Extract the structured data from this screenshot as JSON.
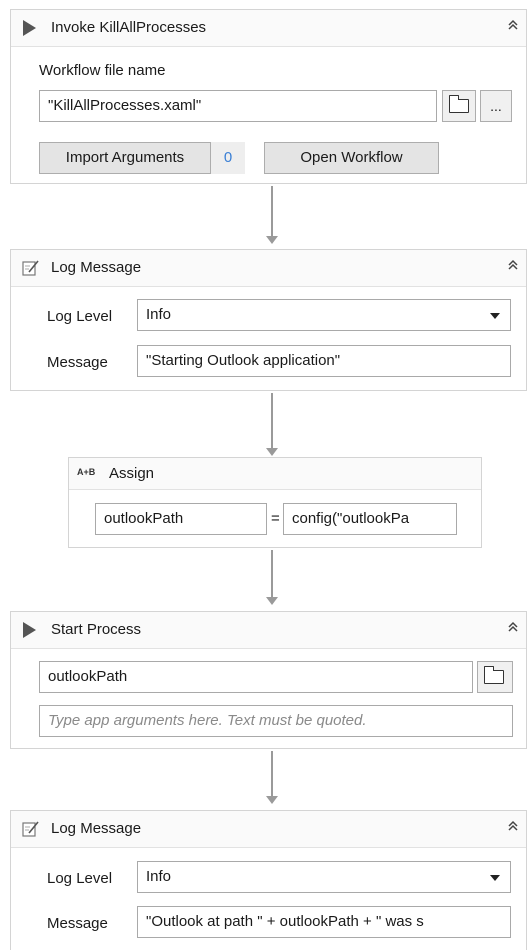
{
  "invoke": {
    "title": "Invoke KillAllProcesses",
    "file_label": "Workflow file name",
    "file_value": "\"KillAllProcesses.xaml\"",
    "browse_icon": "folder-icon",
    "ellipsis_label": "...",
    "import_label": "Import Arguments",
    "import_count": "0",
    "open_label": "Open Workflow"
  },
  "log1": {
    "title": "Log Message",
    "level_label": "Log Level",
    "level_value": "Info",
    "message_label": "Message",
    "message_value": "\"Starting Outlook application\""
  },
  "assign": {
    "icon_text": "A+B",
    "title": "Assign",
    "left_value": "outlookPath",
    "equals": "=",
    "right_value": "config(\"outlookPa"
  },
  "start": {
    "title": "Start Process",
    "path_value": "outlookPath",
    "args_placeholder": "Type app arguments here. Text must be quoted.",
    "browse_icon": "folder-icon"
  },
  "log2": {
    "title": "Log Message",
    "level_label": "Log Level",
    "level_value": "Info",
    "message_label": "Message",
    "message_value": "\"Outlook at path \" + outlookPath + \" was s"
  },
  "colors": {
    "accent_count": "#3a7fd5",
    "connector": "#9a9a9a"
  }
}
